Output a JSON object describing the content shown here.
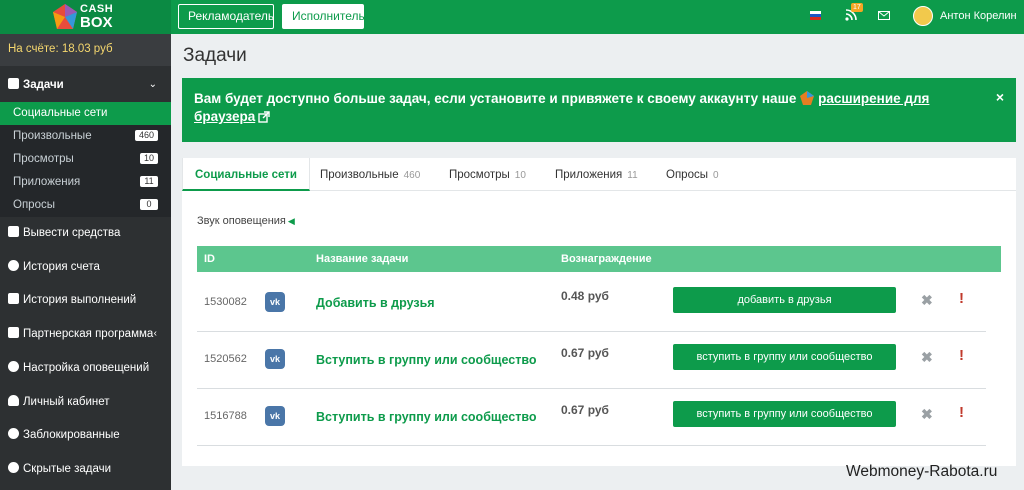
{
  "header": {
    "logo_line1": "CASH",
    "logo_line2": "BOX",
    "advertiser_button": "Рекламодатель",
    "executor_button": "Исполнитель",
    "notification_count": "17",
    "user_name": "Антон Корелин"
  },
  "sidebar": {
    "balance": "На счёте: 18.03 руб",
    "tasks_label": "Задачи",
    "sub_items": [
      {
        "label": "Социальные сети",
        "count": ""
      },
      {
        "label": "Произвольные",
        "count": "460"
      },
      {
        "label": "Просмотры",
        "count": "10"
      },
      {
        "label": "Приложения",
        "count": "11"
      },
      {
        "label": "Опросы",
        "count": "0"
      }
    ],
    "items": [
      "Вывести средства",
      "История счета",
      "История выполнений",
      "Партнерская программа",
      "Настройка оповещений",
      "Личный кабинет",
      "Заблокированные",
      "Скрытые задачи"
    ]
  },
  "main": {
    "title": "Задачи",
    "alert_text": "Вам будет доступно больше задач, если установите и привяжете к своему аккаунту наше",
    "alert_link": "расширение для браузера",
    "alert_close": "×",
    "tabs": [
      {
        "label": "Социальные сети",
        "count": ""
      },
      {
        "label": "Произвольные",
        "count": "460"
      },
      {
        "label": "Просмотры",
        "count": "10"
      },
      {
        "label": "Приложения",
        "count": "11"
      },
      {
        "label": "Опросы",
        "count": "0"
      }
    ],
    "sound_label": "Звук оповещения",
    "table_headers": {
      "id": "ID",
      "name": "Название задачи",
      "reward": "Вознаграждение"
    },
    "rows": [
      {
        "id": "1530082",
        "title": "Добавить в друзья",
        "price": "0.48 руб",
        "action": "добавить в друзья"
      },
      {
        "id": "1520562",
        "title": "Вступить в группу или сообщество",
        "price": "0.67 руб",
        "action": "вступить в группу или сообщество"
      },
      {
        "id": "1516788",
        "title": "Вступить в группу или сообщество",
        "price": "0.67 руб",
        "action": "вступить в группу или сообщество"
      }
    ]
  },
  "watermark": "Webmoney-Rabota.ru",
  "colors": {
    "brand_green": "#0d9b4b",
    "sidebar_dark": "#2d3032",
    "table_header": "#5cc68e",
    "report_red": "#c0392b"
  }
}
